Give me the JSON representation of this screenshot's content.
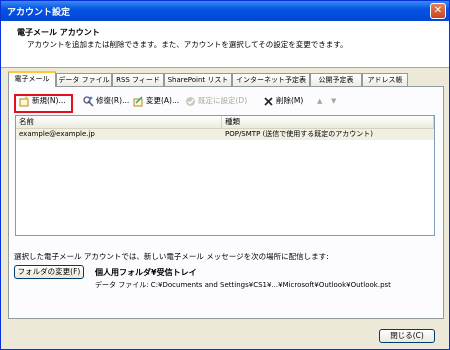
{
  "window": {
    "title": "アカウント設定",
    "close_glyph": "✕"
  },
  "header": {
    "title": "電子メール アカウント",
    "description": "アカウントを追加または削除できます。また、アカウントを選択してその設定を変更できます。"
  },
  "tabs": [
    {
      "label": "電子メール",
      "active": true
    },
    {
      "label": "データ ファイル"
    },
    {
      "label": "RSS フィード"
    },
    {
      "label": "SharePoint リスト"
    },
    {
      "label": "インターネット予定表"
    },
    {
      "label": "公開予定表"
    },
    {
      "label": "アドレス帳"
    }
  ],
  "toolbar": {
    "new_label": "新規(N)...",
    "repair_label": "修復(R)...",
    "change_label": "変更(A)...",
    "default_label": "既定に設定(D)",
    "delete_label": "削除(M)",
    "up_glyph": "▲",
    "down_glyph": "▼"
  },
  "accounts": {
    "columns": [
      "名前",
      "種類"
    ],
    "rows": [
      {
        "name": "example@example.jp",
        "type": "POP/SMTP (送信で使用する既定のアカウント)"
      }
    ]
  },
  "delivery": {
    "text": "選択した電子メール アカウントでは、新しい電子メール メッセージを次の場所に配信します:",
    "change_folder_label": "フォルダの変更(F)",
    "folder": "個人用フォルダ¥受信トレイ",
    "data_file": "データ ファイル: C:¥Documents and Settings¥CS1¥...¥Microsoft¥Outlook¥Outlook.pst"
  },
  "footer": {
    "close_label": "閉じる(C)"
  },
  "colors": {
    "titlebar": "#0554e3",
    "highlight_border": "#e0101c",
    "tab_active_accent": "#ffc83c"
  }
}
